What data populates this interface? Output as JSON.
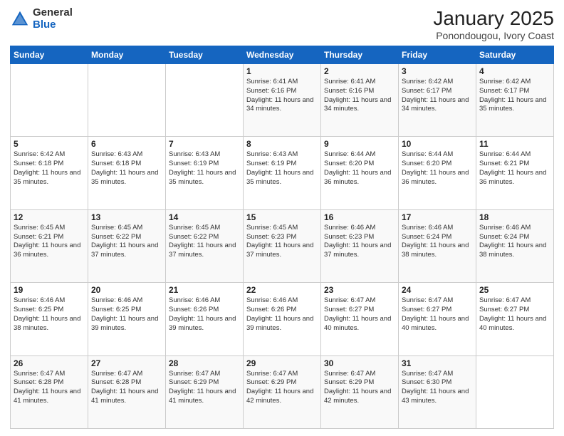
{
  "logo": {
    "general": "General",
    "blue": "Blue"
  },
  "header": {
    "title": "January 2025",
    "subtitle": "Ponondougou, Ivory Coast"
  },
  "days_of_week": [
    "Sunday",
    "Monday",
    "Tuesday",
    "Wednesday",
    "Thursday",
    "Friday",
    "Saturday"
  ],
  "weeks": [
    [
      {
        "day": "",
        "sunrise": "",
        "sunset": "",
        "daylight": ""
      },
      {
        "day": "",
        "sunrise": "",
        "sunset": "",
        "daylight": ""
      },
      {
        "day": "",
        "sunrise": "",
        "sunset": "",
        "daylight": ""
      },
      {
        "day": "1",
        "sunrise": "Sunrise: 6:41 AM",
        "sunset": "Sunset: 6:16 PM",
        "daylight": "Daylight: 11 hours and 34 minutes."
      },
      {
        "day": "2",
        "sunrise": "Sunrise: 6:41 AM",
        "sunset": "Sunset: 6:16 PM",
        "daylight": "Daylight: 11 hours and 34 minutes."
      },
      {
        "day": "3",
        "sunrise": "Sunrise: 6:42 AM",
        "sunset": "Sunset: 6:17 PM",
        "daylight": "Daylight: 11 hours and 34 minutes."
      },
      {
        "day": "4",
        "sunrise": "Sunrise: 6:42 AM",
        "sunset": "Sunset: 6:17 PM",
        "daylight": "Daylight: 11 hours and 35 minutes."
      }
    ],
    [
      {
        "day": "5",
        "sunrise": "Sunrise: 6:42 AM",
        "sunset": "Sunset: 6:18 PM",
        "daylight": "Daylight: 11 hours and 35 minutes."
      },
      {
        "day": "6",
        "sunrise": "Sunrise: 6:43 AM",
        "sunset": "Sunset: 6:18 PM",
        "daylight": "Daylight: 11 hours and 35 minutes."
      },
      {
        "day": "7",
        "sunrise": "Sunrise: 6:43 AM",
        "sunset": "Sunset: 6:19 PM",
        "daylight": "Daylight: 11 hours and 35 minutes."
      },
      {
        "day": "8",
        "sunrise": "Sunrise: 6:43 AM",
        "sunset": "Sunset: 6:19 PM",
        "daylight": "Daylight: 11 hours and 35 minutes."
      },
      {
        "day": "9",
        "sunrise": "Sunrise: 6:44 AM",
        "sunset": "Sunset: 6:20 PM",
        "daylight": "Daylight: 11 hours and 36 minutes."
      },
      {
        "day": "10",
        "sunrise": "Sunrise: 6:44 AM",
        "sunset": "Sunset: 6:20 PM",
        "daylight": "Daylight: 11 hours and 36 minutes."
      },
      {
        "day": "11",
        "sunrise": "Sunrise: 6:44 AM",
        "sunset": "Sunset: 6:21 PM",
        "daylight": "Daylight: 11 hours and 36 minutes."
      }
    ],
    [
      {
        "day": "12",
        "sunrise": "Sunrise: 6:45 AM",
        "sunset": "Sunset: 6:21 PM",
        "daylight": "Daylight: 11 hours and 36 minutes."
      },
      {
        "day": "13",
        "sunrise": "Sunrise: 6:45 AM",
        "sunset": "Sunset: 6:22 PM",
        "daylight": "Daylight: 11 hours and 37 minutes."
      },
      {
        "day": "14",
        "sunrise": "Sunrise: 6:45 AM",
        "sunset": "Sunset: 6:22 PM",
        "daylight": "Daylight: 11 hours and 37 minutes."
      },
      {
        "day": "15",
        "sunrise": "Sunrise: 6:45 AM",
        "sunset": "Sunset: 6:23 PM",
        "daylight": "Daylight: 11 hours and 37 minutes."
      },
      {
        "day": "16",
        "sunrise": "Sunrise: 6:46 AM",
        "sunset": "Sunset: 6:23 PM",
        "daylight": "Daylight: 11 hours and 37 minutes."
      },
      {
        "day": "17",
        "sunrise": "Sunrise: 6:46 AM",
        "sunset": "Sunset: 6:24 PM",
        "daylight": "Daylight: 11 hours and 38 minutes."
      },
      {
        "day": "18",
        "sunrise": "Sunrise: 6:46 AM",
        "sunset": "Sunset: 6:24 PM",
        "daylight": "Daylight: 11 hours and 38 minutes."
      }
    ],
    [
      {
        "day": "19",
        "sunrise": "Sunrise: 6:46 AM",
        "sunset": "Sunset: 6:25 PM",
        "daylight": "Daylight: 11 hours and 38 minutes."
      },
      {
        "day": "20",
        "sunrise": "Sunrise: 6:46 AM",
        "sunset": "Sunset: 6:25 PM",
        "daylight": "Daylight: 11 hours and 39 minutes."
      },
      {
        "day": "21",
        "sunrise": "Sunrise: 6:46 AM",
        "sunset": "Sunset: 6:26 PM",
        "daylight": "Daylight: 11 hours and 39 minutes."
      },
      {
        "day": "22",
        "sunrise": "Sunrise: 6:46 AM",
        "sunset": "Sunset: 6:26 PM",
        "daylight": "Daylight: 11 hours and 39 minutes."
      },
      {
        "day": "23",
        "sunrise": "Sunrise: 6:47 AM",
        "sunset": "Sunset: 6:27 PM",
        "daylight": "Daylight: 11 hours and 40 minutes."
      },
      {
        "day": "24",
        "sunrise": "Sunrise: 6:47 AM",
        "sunset": "Sunset: 6:27 PM",
        "daylight": "Daylight: 11 hours and 40 minutes."
      },
      {
        "day": "25",
        "sunrise": "Sunrise: 6:47 AM",
        "sunset": "Sunset: 6:27 PM",
        "daylight": "Daylight: 11 hours and 40 minutes."
      }
    ],
    [
      {
        "day": "26",
        "sunrise": "Sunrise: 6:47 AM",
        "sunset": "Sunset: 6:28 PM",
        "daylight": "Daylight: 11 hours and 41 minutes."
      },
      {
        "day": "27",
        "sunrise": "Sunrise: 6:47 AM",
        "sunset": "Sunset: 6:28 PM",
        "daylight": "Daylight: 11 hours and 41 minutes."
      },
      {
        "day": "28",
        "sunrise": "Sunrise: 6:47 AM",
        "sunset": "Sunset: 6:29 PM",
        "daylight": "Daylight: 11 hours and 41 minutes."
      },
      {
        "day": "29",
        "sunrise": "Sunrise: 6:47 AM",
        "sunset": "Sunset: 6:29 PM",
        "daylight": "Daylight: 11 hours and 42 minutes."
      },
      {
        "day": "30",
        "sunrise": "Sunrise: 6:47 AM",
        "sunset": "Sunset: 6:29 PM",
        "daylight": "Daylight: 11 hours and 42 minutes."
      },
      {
        "day": "31",
        "sunrise": "Sunrise: 6:47 AM",
        "sunset": "Sunset: 6:30 PM",
        "daylight": "Daylight: 11 hours and 43 minutes."
      },
      {
        "day": "",
        "sunrise": "",
        "sunset": "",
        "daylight": ""
      }
    ]
  ]
}
